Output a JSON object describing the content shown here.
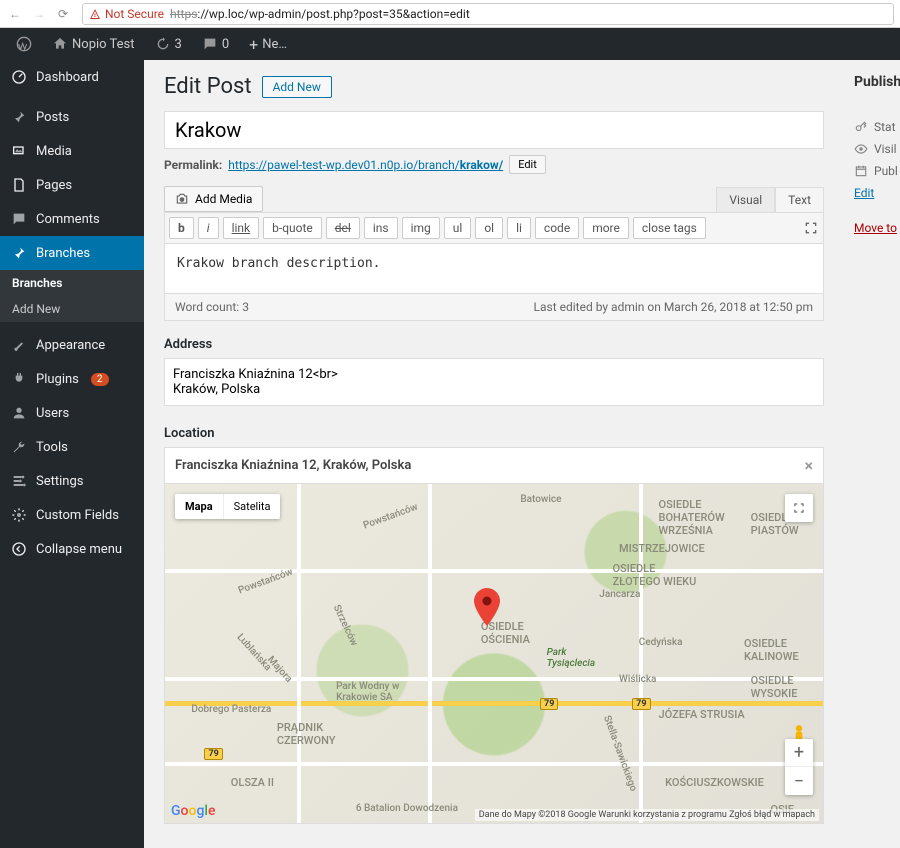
{
  "browser": {
    "not_secure": "Not Secure",
    "url_scheme": "https",
    "url_host_path": "://wp.loc/wp-admin/post.php?post=35&action=edit"
  },
  "adminbar": {
    "site_name": "Nopio Test",
    "updates": "3",
    "comments": "0",
    "new_label": "Ne…"
  },
  "sidebar": {
    "dashboard": "Dashboard",
    "posts": "Posts",
    "media": "Media",
    "pages": "Pages",
    "comments": "Comments",
    "branches": "Branches",
    "branches_sub_all": "Branches",
    "branches_sub_add": "Add New",
    "appearance": "Appearance",
    "plugins": "Plugins",
    "plugins_badge": "2",
    "users": "Users",
    "tools": "Tools",
    "settings": "Settings",
    "custom_fields": "Custom Fields",
    "collapse": "Collapse menu"
  },
  "page": {
    "heading": "Edit Post",
    "add_new": "Add New",
    "title_value": "Krakow",
    "permalink_label": "Permalink:",
    "permalink_base": "https://pawel-test-wp.dev01.n0p.io/branch/",
    "permalink_slug": "krakow/",
    "permalink_edit": "Edit",
    "add_media": "Add Media",
    "tab_visual": "Visual",
    "tab_text": "Text"
  },
  "toolbar": {
    "b": "b",
    "i": "i",
    "link": "link",
    "bquote": "b-quote",
    "del": "del",
    "ins": "ins",
    "img": "img",
    "ul": "ul",
    "ol": "ol",
    "li": "li",
    "code": "code",
    "more": "more",
    "close": "close tags"
  },
  "editor": {
    "body": "Krakow branch description.",
    "word_count_label": "Word count: ",
    "word_count": "3",
    "last_edited": "Last edited by admin on March 26, 2018 at 12:50 pm"
  },
  "address": {
    "label": "Address",
    "value": "Franciszka Kniaźnina 12<br>\nKraków, Polska"
  },
  "location": {
    "label": "Location",
    "search_value": "Franciszka Kniaźnina 12, Kraków, Polska",
    "map_type_map": "Mapa",
    "map_type_sat": "Satelita",
    "credits": "Dane do Mapy ©2018 Google    Warunki korzystania z programu    Zgłoś błąd w mapach",
    "labels": {
      "bohaterow": "OSIEDLE\nBOHATERÓW\nWRZEŚNIA",
      "piastow": "OSIEDLE\nPIASTÓW",
      "mistrzejowice": "MISTRZEJOWICE",
      "zlotego": "OSIEDLE\nZŁOTEGO WIEKU",
      "oscienia": "OSIEDLE\nOŚCIENIA",
      "kalinowe": "OSIEDLE\nKALINOWE",
      "wysokie": "OSIEDLE\nWYSOKIE",
      "strusia": "JÓZEFA STRUSIA",
      "park_tys": "Park\nTysiąclecia",
      "park_wodny": "Park Wodny w\nKrakowie SA",
      "pradnik": "PRĄDNIK\nCZERWONY",
      "olsza": "OLSZA II",
      "batalion": "6 Batalion Dowodzenia",
      "kosciuszkowskie": "KOŚCIUSZKOWSKIE",
      "osiedle_br": "OSIE",
      "jancarza": "Jancarza",
      "cedynska": "Cedyńska",
      "wislicka": "Wiślicka",
      "powstancow": "Powstańców",
      "strzelcow": "Strzelców",
      "dobrego": "Dobrego Pasterza",
      "batowice": "Batowice",
      "lubka": "Lublańska",
      "majora": "Majora",
      "sawickiego": "Stella-Sawickiego",
      "shield79a": "79",
      "shield79b": "79",
      "shield79c": "79"
    }
  },
  "publish": {
    "title": "Publish",
    "status": "Stat",
    "visibility": "Visil",
    "published": "Publ",
    "edit": "Edit",
    "trash": "Move to"
  }
}
